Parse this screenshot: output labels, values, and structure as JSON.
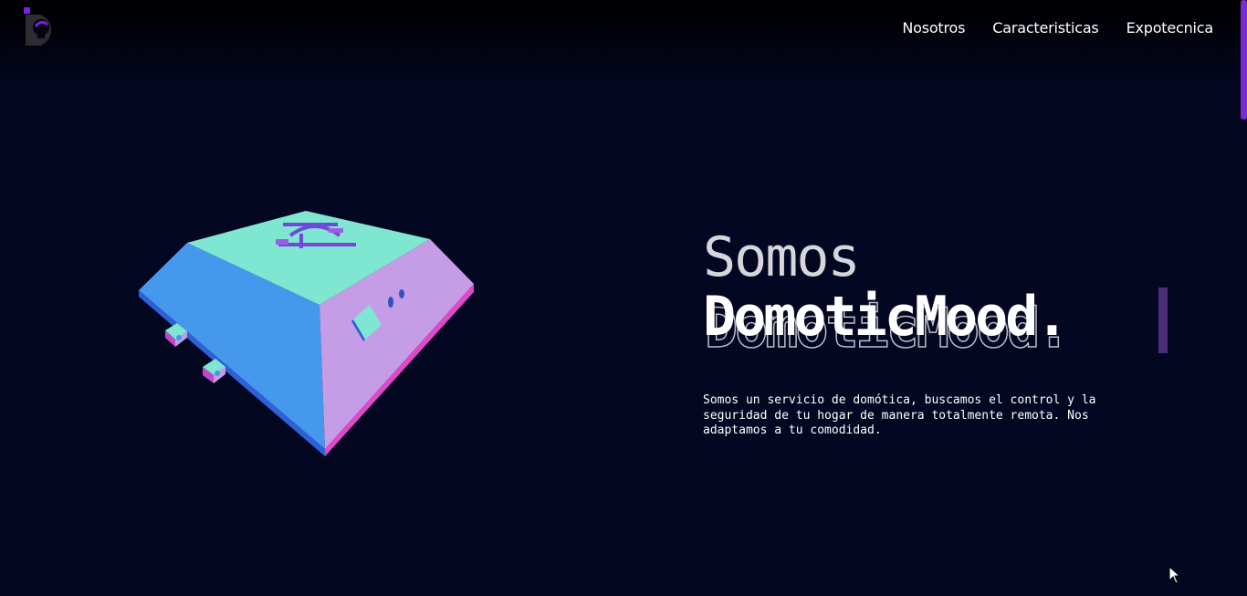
{
  "header": {
    "logo_icon": "domoticmood-logo-icon",
    "nav": [
      {
        "label": "Nosotros"
      },
      {
        "label": "Caracteristicas"
      },
      {
        "label": "Expotecnica"
      }
    ]
  },
  "hero": {
    "intro": "Somos",
    "title": "DomoticMood.",
    "description": "Somos un servicio de domótica, buscamos el control y la seguridad de tu hogar de manera totalmente remota. Nos adaptamos a tu comodidad."
  },
  "colors": {
    "background": "#030721",
    "accent": "#7a2ad2",
    "model_top": "#7fe6d2",
    "model_left": "#4698ec",
    "model_right": "#c59de6"
  },
  "icons": {
    "model": "device-3d-model",
    "cursor": "mouse-pointer-icon"
  }
}
